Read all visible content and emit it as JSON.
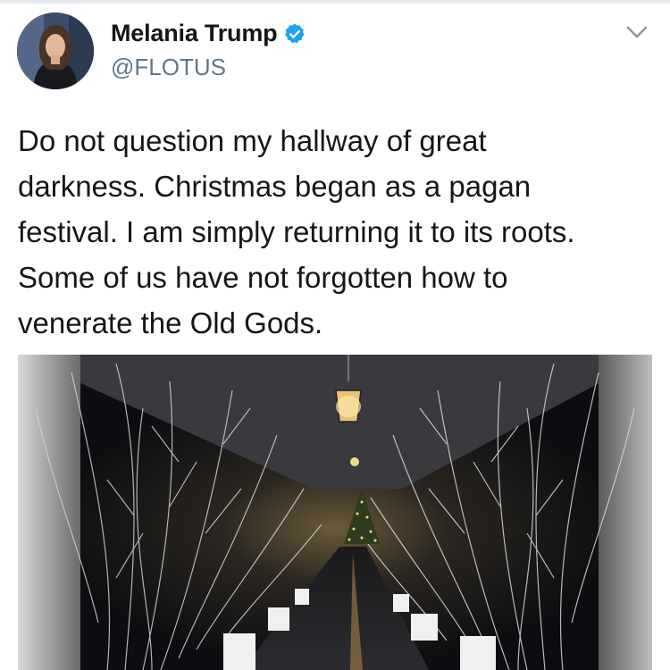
{
  "tweet": {
    "author": {
      "display_name": "Melania Trump",
      "handle": "@FLOTUS",
      "verified": true,
      "verified_icon": "verified-badge-icon",
      "avatar_icon": "profile-photo"
    },
    "menu_icon": "chevron-down-icon",
    "text_lines": [
      "Do not question my hallway of great",
      "darkness. Christmas began as a pagan",
      "festival. I am simply returning it to its roots.",
      "Some of us have not forgotten how to",
      "venerate the Old Gods."
    ],
    "media": {
      "type": "photo",
      "icon": "hallway-photo"
    }
  },
  "colors": {
    "verified_blue": "#1da1f2",
    "text_primary": "#14171a",
    "text_secondary": "#657786",
    "border": "#e6ecf0"
  }
}
